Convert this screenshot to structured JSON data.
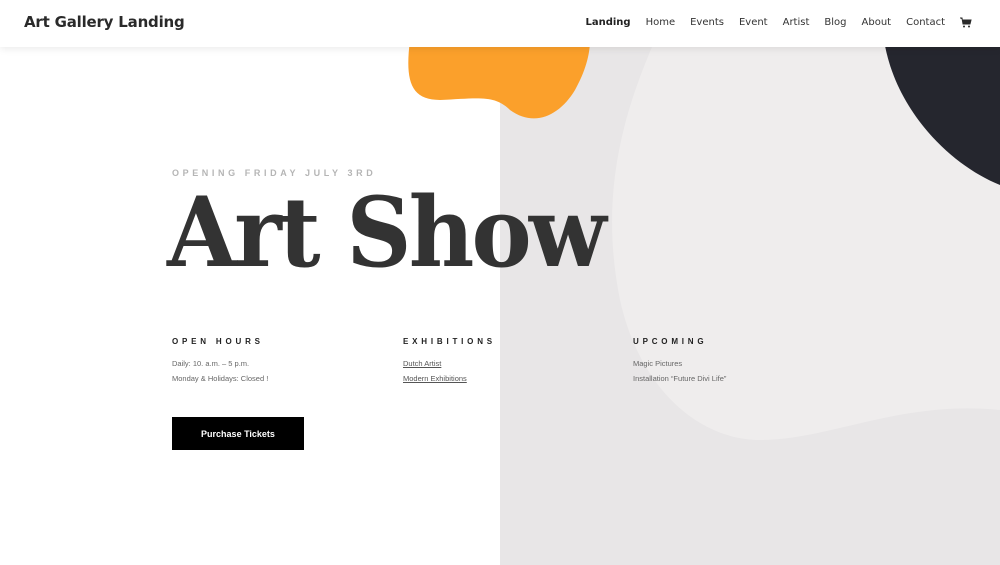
{
  "header": {
    "logo": "Art Gallery Landing",
    "nav": [
      {
        "label": "Landing",
        "active": true
      },
      {
        "label": "Home"
      },
      {
        "label": "Events"
      },
      {
        "label": "Event"
      },
      {
        "label": "Artist"
      },
      {
        "label": "Blog"
      },
      {
        "label": "About"
      },
      {
        "label": "Contact"
      }
    ],
    "cart_icon": "shopping-cart-icon"
  },
  "hero": {
    "eyebrow": "OPENING FRIDAY JULY 3RD",
    "title": "Art Show"
  },
  "info": {
    "open_hours": {
      "heading": "OPEN HOURS",
      "lines": [
        "Daily: 10. a.m. – 5 p.m.",
        "Monday & Holidays: Closed !"
      ]
    },
    "exhibitions": {
      "heading": "EXHIBITIONS",
      "links": [
        "Dutch Artist",
        "Modern Exhibitions"
      ]
    },
    "upcoming": {
      "heading": "UPCOMING",
      "lines": [
        "Magic Pictures",
        "Installation “Future Divi Life”"
      ]
    }
  },
  "cta": {
    "label": "Purchase Tickets"
  },
  "colors": {
    "accent_orange": "#fba02b",
    "dark_shape": "#25262e",
    "panel_gray": "#e8e6e7",
    "button_bg": "#000000"
  }
}
